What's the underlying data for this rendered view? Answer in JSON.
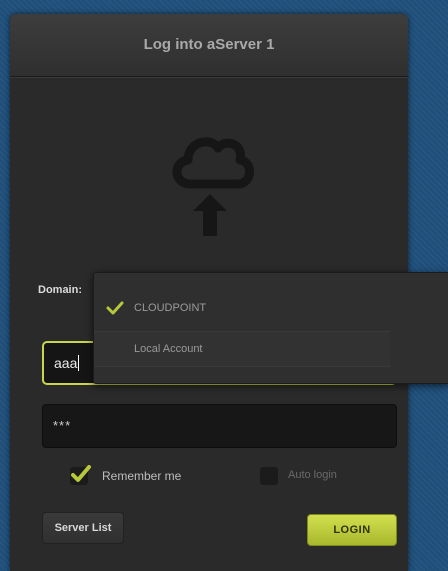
{
  "window": {
    "title": "Log into aServer 1"
  },
  "logo": {
    "icon": "cloud-upload-icon"
  },
  "domain": {
    "label": "Domain:",
    "selected": "CLOUDPOINT",
    "options": [
      "CLOUDPOINT",
      "Local Account"
    ]
  },
  "username": {
    "value": "aaa"
  },
  "password": {
    "value": "***"
  },
  "options": {
    "remember_label": "Remember me",
    "remember_checked": true,
    "autologin_label": "Auto login",
    "autologin_checked": false
  },
  "buttons": {
    "server_list": "Server List",
    "login": "LOGIN"
  },
  "colors": {
    "accent": "#c9d64a",
    "panel": "#2a2a2a",
    "background": "#1f4f7a"
  }
}
